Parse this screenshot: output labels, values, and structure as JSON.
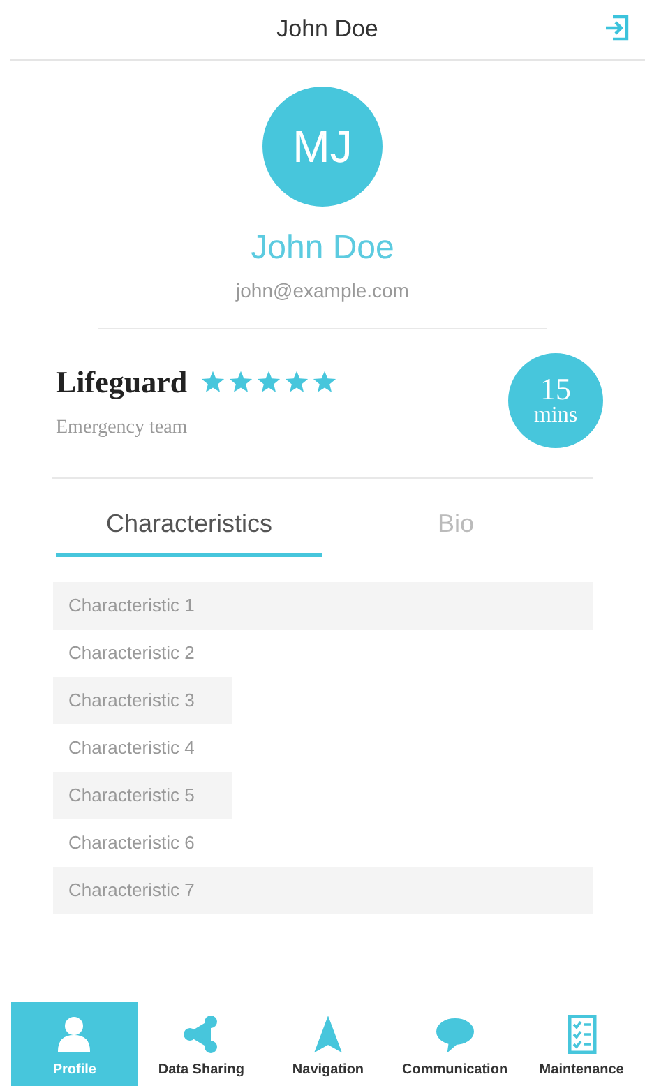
{
  "header": {
    "title": "John Doe"
  },
  "profile": {
    "initials": "MJ",
    "name": "John Doe",
    "email": "john@example.com"
  },
  "role": {
    "title": "Lifeguard",
    "stars": 5,
    "team": "Emergency team",
    "time_value": "15",
    "time_unit": "mins"
  },
  "tabs": [
    {
      "label": "Characteristics",
      "selected": true
    },
    {
      "label": "Bio",
      "selected": false
    }
  ],
  "characteristics": [
    {
      "label": "Characteristic 1",
      "kind": "wide"
    },
    {
      "label": "Characteristic 2",
      "kind": "plain"
    },
    {
      "label": "Characteristic 3",
      "kind": "shaded"
    },
    {
      "label": "Characteristic 4",
      "kind": "plain"
    },
    {
      "label": "Characteristic 5",
      "kind": "shaded"
    },
    {
      "label": "Characteristic 6",
      "kind": "plain"
    },
    {
      "label": "Characteristic 7",
      "kind": "wide"
    }
  ],
  "bottom_nav": [
    {
      "label": "Profile",
      "kind": "person",
      "selected": true
    },
    {
      "label": "Data Sharing",
      "kind": "share",
      "selected": false
    },
    {
      "label": "Navigation",
      "kind": "arrow",
      "selected": false
    },
    {
      "label": "Communication",
      "kind": "chat",
      "selected": false
    },
    {
      "label": "Maintenance",
      "kind": "checklist",
      "selected": false
    }
  ]
}
